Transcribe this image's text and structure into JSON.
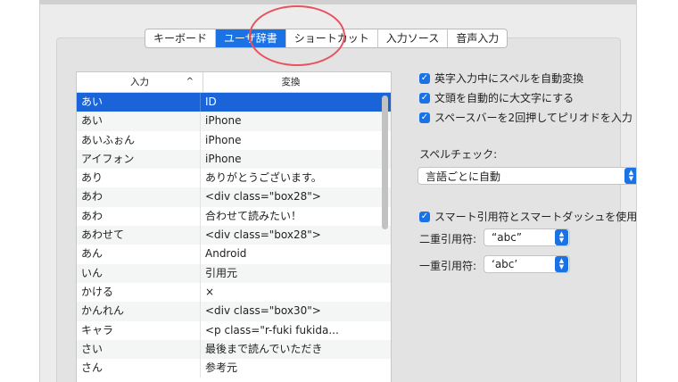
{
  "tabs": [
    "キーボード",
    "ユーザ辞書",
    "ショートカット",
    "入力ソース",
    "音声入力"
  ],
  "active_tab": "ユーザ辞書",
  "table": {
    "col_input": "入力",
    "col_output": "変換",
    "sort_indicator": "^",
    "rows": [
      {
        "input": "あい",
        "output": "ID"
      },
      {
        "input": "あい",
        "output": "iPhone"
      },
      {
        "input": "あいふぉん",
        "output": "iPhone"
      },
      {
        "input": "アイフォン",
        "output": "iPhone"
      },
      {
        "input": "あり",
        "output": "ありがとうございます。"
      },
      {
        "input": "あわ",
        "output": "<div class=\"box28\">"
      },
      {
        "input": "あわ",
        "output": "合わせて読みたい！"
      },
      {
        "input": "あわせて",
        "output": "<div class=\"box28\">"
      },
      {
        "input": "あん",
        "output": "Android"
      },
      {
        "input": "いん",
        "output": "引用元"
      },
      {
        "input": "かける",
        "output": "×"
      },
      {
        "input": "かんれん",
        "output": "<div class=\"box30\">"
      },
      {
        "input": "キャラ",
        "output": "<p class=\"r-fuki fukida..."
      },
      {
        "input": "さい",
        "output": "最後まで読んでいただき"
      },
      {
        "input": "さん",
        "output": "参考元"
      }
    ]
  },
  "options": {
    "auto_spell": "英字入力中にスペルを自動変換",
    "auto_capitalize": "文頭を自動的に大文字にする",
    "period_double_space": "スペースバーを2回押してピリオドを入力",
    "spell_check_label": "スペルチェック:",
    "spell_check_value": "言語ごとに自動",
    "smart_quotes": "スマート引用符とスマートダッシュを使用",
    "double_quote_label": "二重引用符:",
    "double_quote_value": "“abc”",
    "single_quote_label": "一重引用符:",
    "single_quote_value": "‘abc’"
  },
  "colors": {
    "accent": "#1a72e5",
    "selection": "#1a63d8",
    "highlight_ring": "#e8525e"
  }
}
